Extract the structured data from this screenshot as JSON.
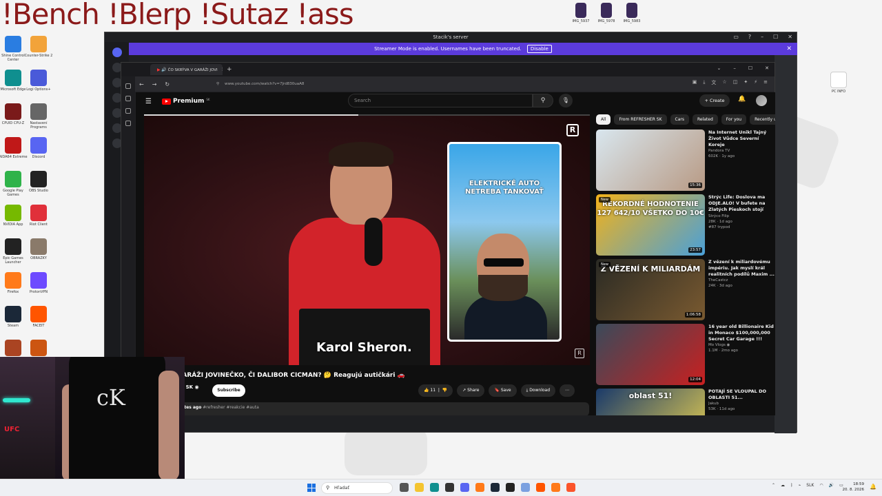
{
  "overlay": {
    "title": "!Bench !Blerp !Sutaz !ass"
  },
  "desktop": {
    "icons": [
      {
        "label": "Shine Control Center",
        "color": "#2a7de1"
      },
      {
        "label": "Counter-Strike 2",
        "color": "#f2a33a"
      },
      {
        "label": "Microsoft Edge",
        "color": "#0f8f8f"
      },
      {
        "label": "Logi Options+",
        "color": "#4a5ad9"
      },
      {
        "label": "CPUID CPU-Z",
        "color": "#7a1a1a"
      },
      {
        "label": "Nastavení Programs",
        "color": "#666666"
      },
      {
        "label": "AIDA64 Extreme",
        "color": "#c01818"
      },
      {
        "label": "Discord",
        "color": "#5865f2"
      },
      {
        "label": "Google Play Games",
        "color": "#2fb34a"
      },
      {
        "label": "OBS Studio",
        "color": "#222222"
      },
      {
        "label": "NVIDIA App",
        "color": "#76b900"
      },
      {
        "label": "Riot Client",
        "color": "#e0303a"
      },
      {
        "label": "Epic Games Launcher",
        "color": "#222222"
      },
      {
        "label": "OBRÁZKY",
        "color": "#8a7a6a"
      },
      {
        "label": "Firefox",
        "color": "#ff7a1a"
      },
      {
        "label": "ProtonVPN",
        "color": "#6d4aff"
      },
      {
        "label": "Steam",
        "color": "#1b2838"
      },
      {
        "label": "FACEIT",
        "color": "#ff5500"
      },
      {
        "label": "",
        "color": "#aa4422"
      },
      {
        "label": "",
        "color": "#cc5511"
      }
    ],
    "top_files": [
      {
        "label": "IMG_5937"
      },
      {
        "label": "IMG_5978"
      },
      {
        "label": "IMG_5983"
      }
    ],
    "right_file": {
      "label": "PC INFO"
    }
  },
  "discord": {
    "title": "Stacik's server",
    "banner": "Streamer Mode is enabled. Usernames have been truncated.",
    "disable": "Disable",
    "close": "✕"
  },
  "browser": {
    "tab_title": "ČO SKRÝVA V GARÁŽI JOVI",
    "tab_close": "✕",
    "new_tab": "+",
    "url": "www.youtube.com/watch?v=7Jrd830uaA8",
    "controls": {
      "min": "–",
      "max": "☐",
      "close": "✕",
      "menu": "⌄"
    }
  },
  "youtube": {
    "brand": "Premium",
    "region": "SK",
    "search_placeholder": "Search",
    "create": "Create",
    "video": {
      "inset_text_1": "ELEKTRICKÉ AUTO",
      "inset_text_2": "NETREBA TANKOVAŤ",
      "lower_third": "Karol Sheron.",
      "progress": 0.48
    },
    "title": "GARÁŽI JOVINEČKO, ČI DALIBOR CICMAN? 🤔 Reagujú autičkári 🚗",
    "channel": "ER SK ◉",
    "subs": "ers",
    "subscribe": "Subscribe",
    "likes": "11",
    "share": "Share",
    "save": "Save",
    "download": "Download",
    "more": "⋯",
    "desc_time": "utes ago",
    "desc_tags": "#refresher #reakcie #auta",
    "chips": [
      "All",
      "From REFRESHER SK",
      "Cars",
      "Related",
      "For you",
      "Recently u"
    ],
    "recommendations": [
      {
        "title": "Na Internet Unikl Tajný Život Vůdce Severní Koreje",
        "channel": "Pandora TV",
        "stats": "602K · 1y ago",
        "extra": "",
        "duration": "15:36",
        "new": "",
        "thumb_text": "",
        "c1": "#d8e6ee",
        "c2": "#b89a84"
      },
      {
        "title": "Strýc Life: Doslova ma ODJE.ALO! V bufete na Zlatých Pieskoch stojí porci...",
        "channel": "Strýco Filip",
        "stats": "28K · 1d ago",
        "extra": "#87 trypod",
        "duration": "23:57",
        "new": "New",
        "thumb_text": "REKORDNÉ HODNOTENIE 127 642/10 VŠETKO DO 10€",
        "c1": "#f2b21a",
        "c2": "#4aa0d8"
      },
      {
        "title": "Z vězení k miliardovému impériu. Jak myslí král realitních podílů Maxim ...",
        "channel": "TheCastcz",
        "stats": "24K · 3d ago",
        "extra": "",
        "duration": "1:06:58",
        "new": "New",
        "thumb_text": "Z VĚZENÍ K MILIARDÁM",
        "c1": "#2a2a24",
        "c2": "#7a5a30"
      },
      {
        "title": "16 year old Billionaire Kid in Monaco $100,000,000 Secret Car Garage !!!",
        "channel": "Mo Vlogs ◉",
        "stats": "1.1M · 2mo ago",
        "extra": "",
        "duration": "12:04",
        "new": "",
        "thumb_text": "",
        "c1": "#3a4a5a",
        "c2": "#c82020"
      },
      {
        "title": "POTAJÍ SE VLOUPAL DO OBLASTI 51...",
        "channel": "Jakub",
        "stats": "53K · 11d ago",
        "extra": "",
        "duration": "",
        "new": "",
        "thumb_text": "oblast 51!",
        "c1": "#1a3a6a",
        "c2": "#e8d050"
      }
    ]
  },
  "webcam": {
    "logo": "cK",
    "sign": "UFC"
  },
  "taskbar": {
    "search": "Hľadať",
    "lang": "SLK",
    "time": "18:59",
    "date": "20. 8. 2026",
    "apps": [
      {
        "name": "task-view",
        "color": "#555555"
      },
      {
        "name": "file-explorer",
        "color": "#f4c430"
      },
      {
        "name": "edge",
        "color": "#0f8f8f"
      },
      {
        "name": "obs",
        "color": "#333333"
      },
      {
        "name": "discord",
        "color": "#5865f2"
      },
      {
        "name": "firefox",
        "color": "#ff7a1a"
      },
      {
        "name": "steam",
        "color": "#1b2838"
      },
      {
        "name": "media",
        "color": "#222222"
      },
      {
        "name": "browser",
        "color": "#7aa0e0"
      },
      {
        "name": "faceit",
        "color": "#ff5500"
      },
      {
        "name": "firefox-2",
        "color": "#ff7a1a"
      },
      {
        "name": "brave",
        "color": "#fb542b"
      }
    ]
  }
}
